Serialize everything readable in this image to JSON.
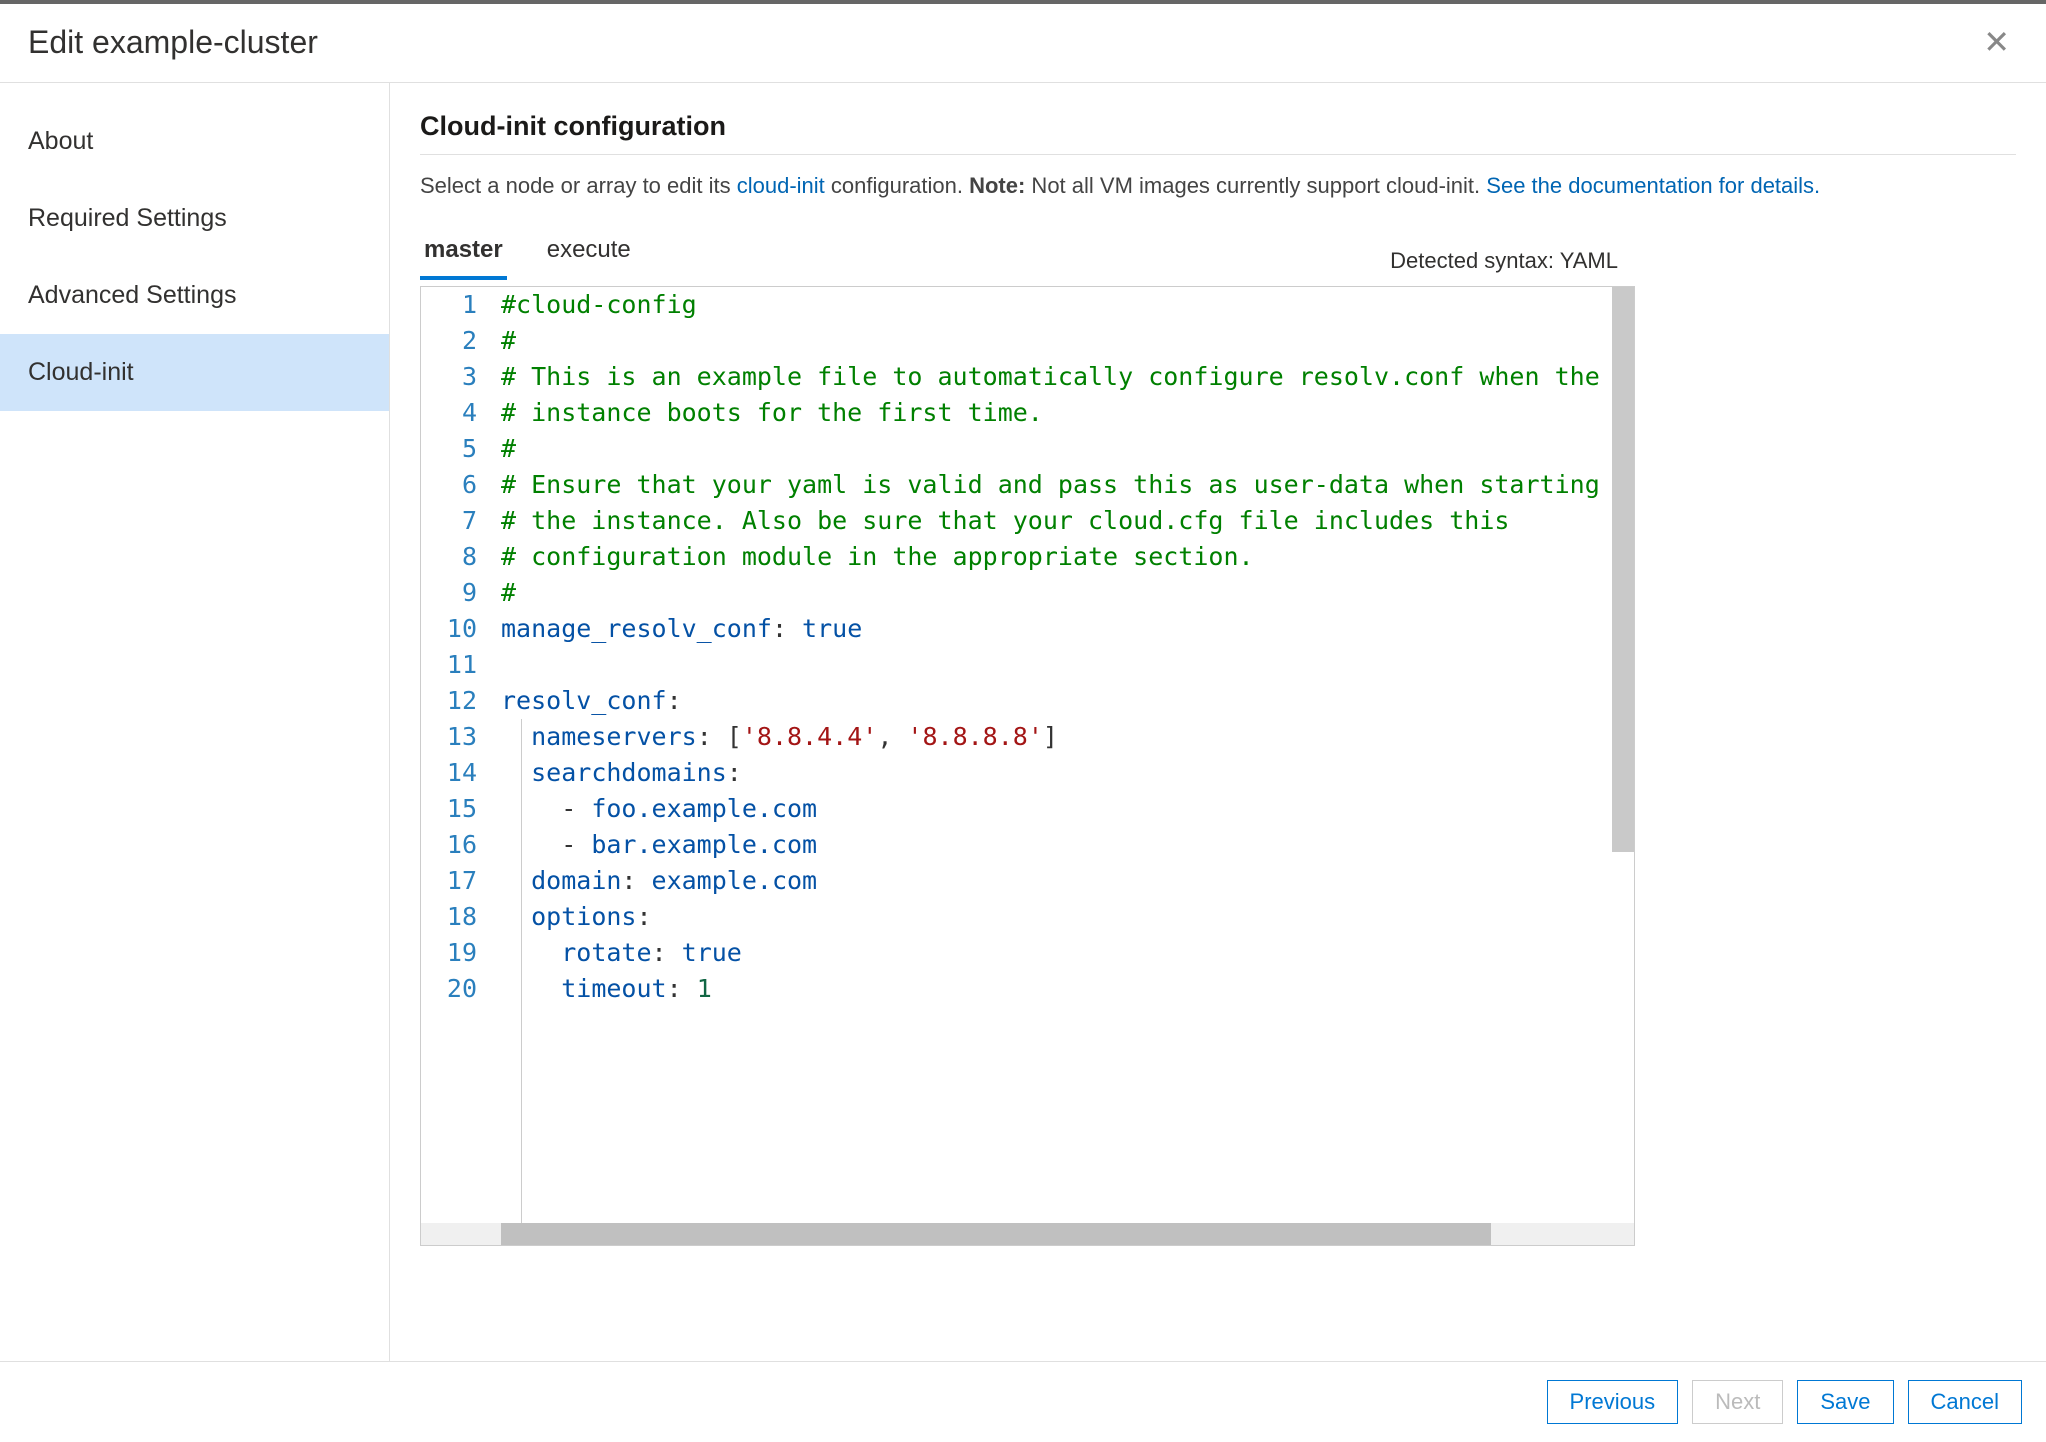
{
  "header": {
    "title": "Edit example-cluster"
  },
  "sidebar": {
    "items": [
      {
        "label": "About",
        "active": false
      },
      {
        "label": "Required Settings",
        "active": false
      },
      {
        "label": "Advanced Settings",
        "active": false
      },
      {
        "label": "Cloud-init",
        "active": true
      }
    ]
  },
  "main": {
    "title": "Cloud-init configuration",
    "desc_pre": "Select a node or array to edit its ",
    "desc_link1": "cloud-init",
    "desc_mid": " configuration. ",
    "desc_note_label": "Note:",
    "desc_note_text": " Not all VM images currently support cloud-init. ",
    "desc_link2": "See the documentation for details.",
    "tabs": [
      {
        "label": "master",
        "active": true
      },
      {
        "label": "execute",
        "active": false
      }
    ],
    "syntax_label": "Detected syntax: YAML",
    "editor": {
      "language": "yaml",
      "lines": [
        {
          "n": 1,
          "segs": [
            {
              "c": "comment",
              "t": "#cloud-config"
            }
          ]
        },
        {
          "n": 2,
          "segs": [
            {
              "c": "comment",
              "t": "#"
            }
          ]
        },
        {
          "n": 3,
          "segs": [
            {
              "c": "comment",
              "t": "# This is an example file to automatically configure resolv.conf when the"
            }
          ]
        },
        {
          "n": 4,
          "segs": [
            {
              "c": "comment",
              "t": "# instance boots for the first time."
            }
          ]
        },
        {
          "n": 5,
          "segs": [
            {
              "c": "comment",
              "t": "#"
            }
          ]
        },
        {
          "n": 6,
          "segs": [
            {
              "c": "comment",
              "t": "# Ensure that your yaml is valid and pass this as user-data when starting"
            }
          ]
        },
        {
          "n": 7,
          "segs": [
            {
              "c": "comment",
              "t": "# the instance. Also be sure that your cloud.cfg file includes this"
            }
          ]
        },
        {
          "n": 8,
          "segs": [
            {
              "c": "comment",
              "t": "# configuration module in the appropriate section."
            }
          ]
        },
        {
          "n": 9,
          "segs": [
            {
              "c": "comment",
              "t": "#"
            }
          ]
        },
        {
          "n": 10,
          "segs": [
            {
              "c": "key",
              "t": "manage_resolv_conf"
            },
            {
              "c": "",
              "t": ": "
            },
            {
              "c": "bool",
              "t": "true"
            }
          ]
        },
        {
          "n": 11,
          "segs": [
            {
              "c": "",
              "t": ""
            }
          ]
        },
        {
          "n": 12,
          "segs": [
            {
              "c": "key",
              "t": "resolv_conf"
            },
            {
              "c": "",
              "t": ":"
            }
          ]
        },
        {
          "n": 13,
          "segs": [
            {
              "c": "",
              "t": "  "
            },
            {
              "c": "key",
              "t": "nameservers"
            },
            {
              "c": "",
              "t": ": ["
            },
            {
              "c": "str",
              "t": "'8.8.4.4'"
            },
            {
              "c": "",
              "t": ", "
            },
            {
              "c": "str",
              "t": "'8.8.8.8'"
            },
            {
              "c": "",
              "t": "]"
            }
          ]
        },
        {
          "n": 14,
          "segs": [
            {
              "c": "",
              "t": "  "
            },
            {
              "c": "key",
              "t": "searchdomains"
            },
            {
              "c": "",
              "t": ":"
            }
          ]
        },
        {
          "n": 15,
          "segs": [
            {
              "c": "",
              "t": "    - "
            },
            {
              "c": "plain",
              "t": "foo.example.com"
            }
          ]
        },
        {
          "n": 16,
          "segs": [
            {
              "c": "",
              "t": "    - "
            },
            {
              "c": "plain",
              "t": "bar.example.com"
            }
          ]
        },
        {
          "n": 17,
          "segs": [
            {
              "c": "",
              "t": "  "
            },
            {
              "c": "key",
              "t": "domain"
            },
            {
              "c": "",
              "t": ": "
            },
            {
              "c": "plain",
              "t": "example.com"
            }
          ]
        },
        {
          "n": 18,
          "segs": [
            {
              "c": "",
              "t": "  "
            },
            {
              "c": "key",
              "t": "options"
            },
            {
              "c": "",
              "t": ":"
            }
          ]
        },
        {
          "n": 19,
          "segs": [
            {
              "c": "",
              "t": "    "
            },
            {
              "c": "key",
              "t": "rotate"
            },
            {
              "c": "",
              "t": ": "
            },
            {
              "c": "bool",
              "t": "true"
            }
          ]
        },
        {
          "n": 20,
          "segs": [
            {
              "c": "",
              "t": "    "
            },
            {
              "c": "key",
              "t": "timeout"
            },
            {
              "c": "",
              "t": ": "
            },
            {
              "c": "num",
              "t": "1"
            }
          ]
        }
      ]
    }
  },
  "footer": {
    "previous": "Previous",
    "next": "Next",
    "save": "Save",
    "cancel": "Cancel"
  }
}
